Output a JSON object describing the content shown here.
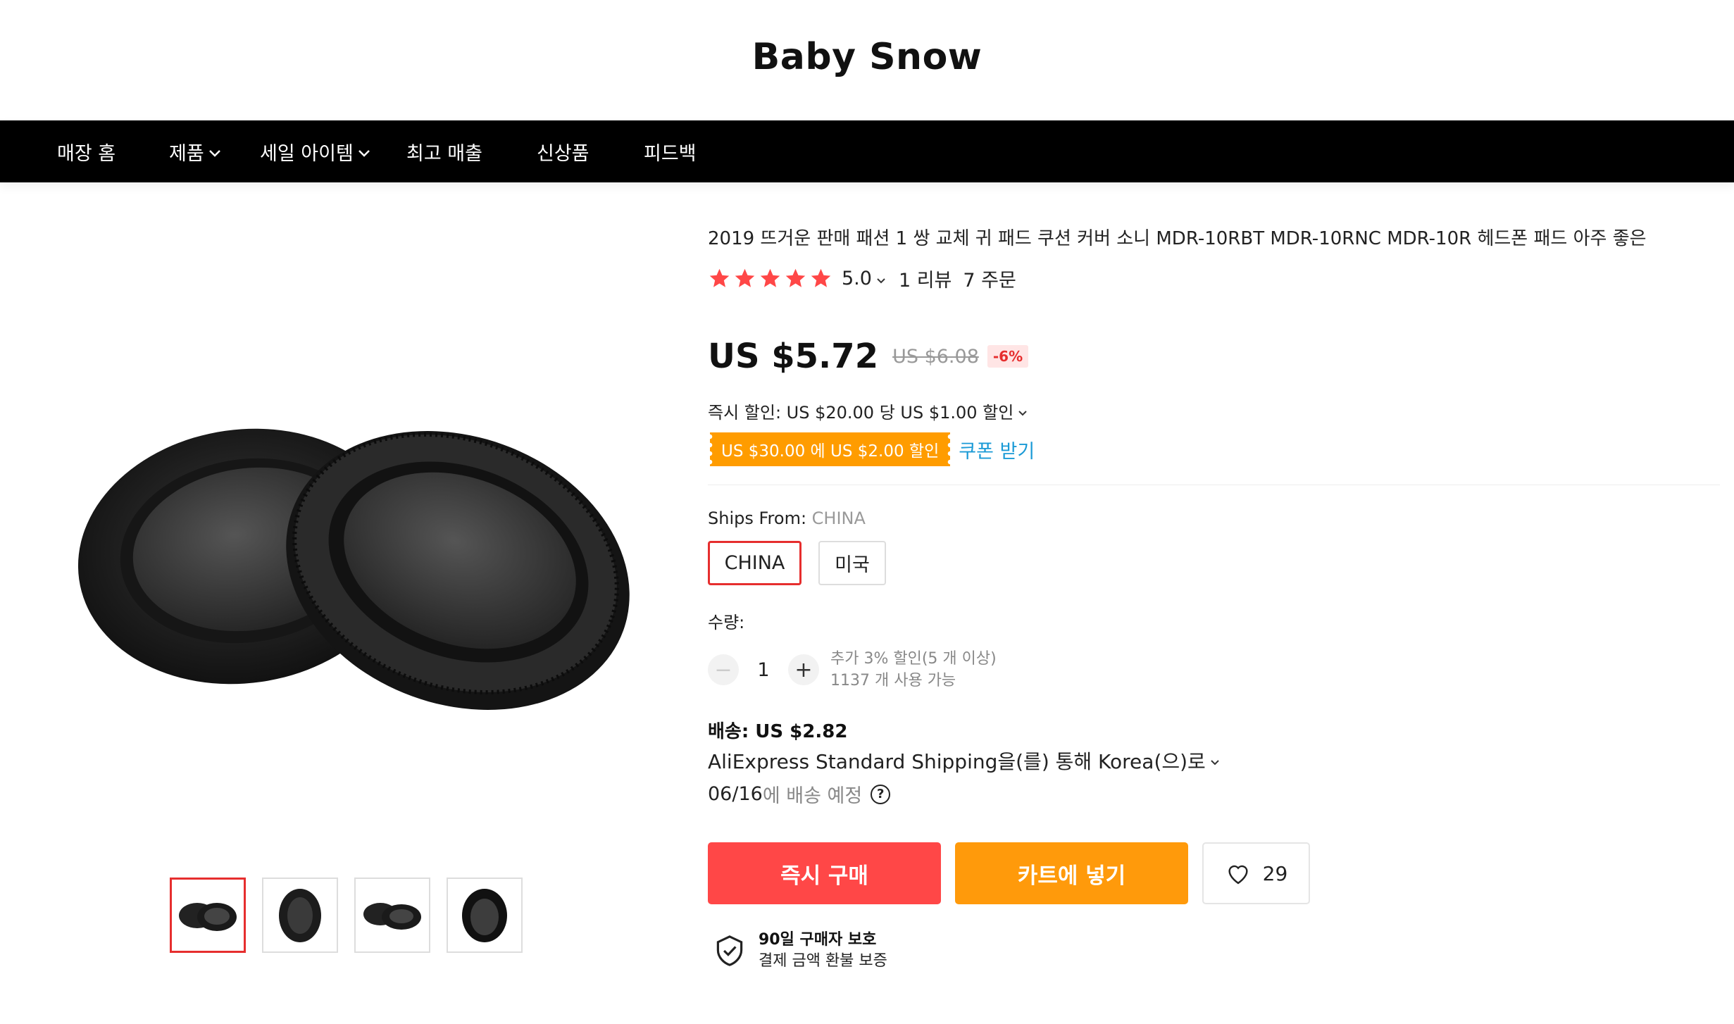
{
  "store": {
    "name": "Baby Snow"
  },
  "nav": {
    "items": [
      {
        "label": "매장 홈",
        "has_dropdown": false
      },
      {
        "label": "제품",
        "has_dropdown": true
      },
      {
        "label": "세일 아이템",
        "has_dropdown": true
      },
      {
        "label": "최고 매출",
        "has_dropdown": false
      },
      {
        "label": "신상품",
        "has_dropdown": false
      },
      {
        "label": "피드백",
        "has_dropdown": false
      }
    ]
  },
  "product": {
    "title": "2019 뜨거운 판매 패션 1 쌍 교체 귀 패드 쿠션 커버 소니 MDR-10RBT MDR-10RNC MDR-10R 헤드폰 패드 아주 좋은",
    "rating": {
      "stars": 5,
      "score": "5.0",
      "reviews": "1 리뷰",
      "orders": "7 주문"
    },
    "price": {
      "current": "US $5.72",
      "original": "US $6.08",
      "discount": "-6%"
    },
    "instant_discount": "즉시 할인: US $20.00 당 US $1.00 할인",
    "coupon": {
      "tag": "US $30.00 에 US $2.00 할인",
      "link": "쿠폰 받기"
    },
    "ships_from": {
      "label": "Ships From: ",
      "value": "CHINA",
      "options": [
        "CHINA",
        "미국"
      ],
      "selected": "CHINA"
    },
    "quantity": {
      "label": "수량:",
      "value": "1",
      "minus": "−",
      "plus": "+",
      "note_discount": "추가 3% 할인(5 개 이상)",
      "note_available": "1137 개 사용 가능"
    },
    "shipping": {
      "cost": "배송: US $2.82",
      "method": "AliExpress Standard Shipping을(를) 통해 Korea(으)로",
      "date": "06/16",
      "date_suffix": "에 배송 예정",
      "help_icon": "?"
    },
    "actions": {
      "buy_now": "즉시 구매",
      "add_to_cart": "카트에 넣기",
      "wishlist_count": "29"
    },
    "protection": {
      "title": "90일 구매자 보호",
      "subtitle": "결제 금액 환불 보증"
    },
    "gallery": {
      "thumbnail_count": 4,
      "active_index": 0
    }
  },
  "colors": {
    "accent_red": "#ff4747",
    "accent_orange": "#ff9a0b",
    "coupon_orange": "#ff9c00",
    "star": "#ff4747",
    "link_blue": "#1a9ad6",
    "nav_bg": "#000000"
  }
}
